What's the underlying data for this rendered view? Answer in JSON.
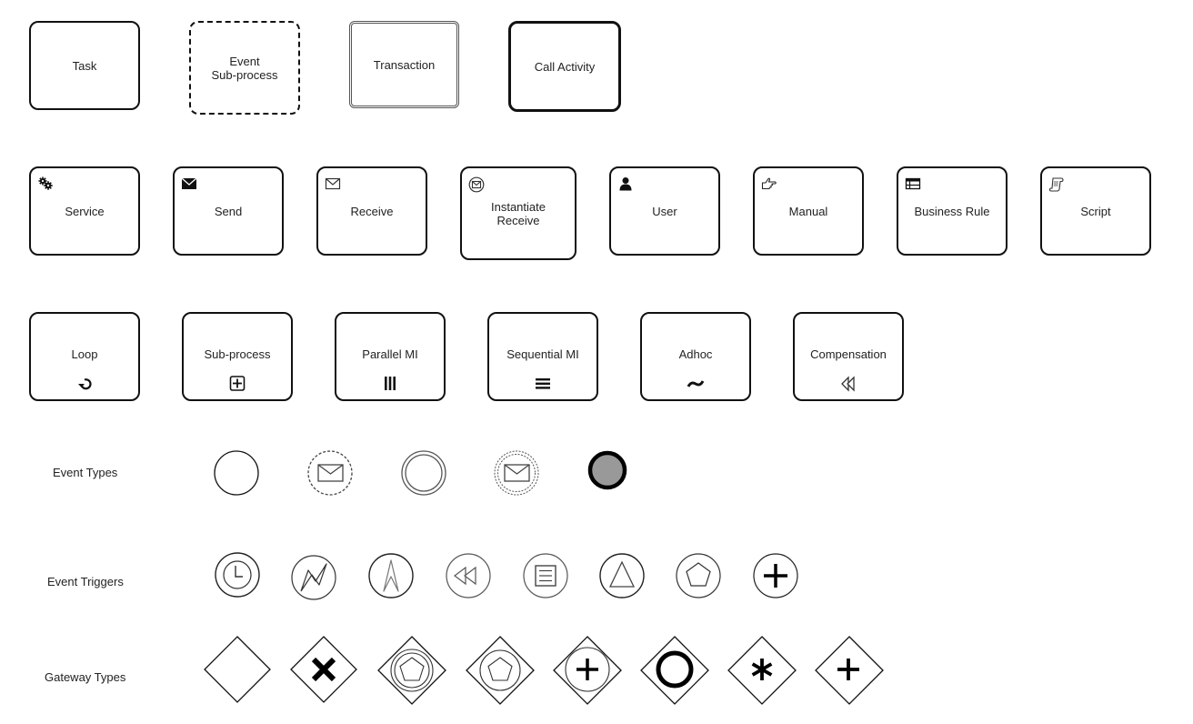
{
  "activities": [
    {
      "label": "Task",
      "style": "normal"
    },
    {
      "label": "Event\nSub-process",
      "style": "dashed"
    },
    {
      "label": "Transaction",
      "style": "double"
    },
    {
      "label": "Call Activity",
      "style": "thick"
    }
  ],
  "task_types": [
    {
      "label": "Service",
      "icon": "gears-icon"
    },
    {
      "label": "Send",
      "icon": "filled-envelope-icon"
    },
    {
      "label": "Receive",
      "icon": "envelope-icon"
    },
    {
      "label": "Instantiate\nReceive",
      "icon": "circled-envelope-icon"
    },
    {
      "label": "User",
      "icon": "user-icon"
    },
    {
      "label": "Manual",
      "icon": "hand-icon"
    },
    {
      "label": "Business Rule",
      "icon": "table-icon"
    },
    {
      "label": "Script",
      "icon": "scroll-icon"
    }
  ],
  "markers": [
    {
      "label": "Loop",
      "icon": "loop-icon"
    },
    {
      "label": "Sub-process",
      "icon": "plus-box-icon"
    },
    {
      "label": "Parallel MI",
      "icon": "parallel-bars-icon"
    },
    {
      "label": "Sequential MI",
      "icon": "sequential-bars-icon"
    },
    {
      "label": "Adhoc",
      "icon": "tilde-icon"
    },
    {
      "label": "Compensation",
      "icon": "rewind-icon"
    }
  ],
  "event_types": {
    "label": "Event Types",
    "items": [
      "start-event",
      "non-interrupting-message-event",
      "intermediate-event",
      "non-interrupting-intermediate-message-event",
      "end-event"
    ]
  },
  "event_triggers": {
    "label": "Event Triggers",
    "items": [
      "timer-icon",
      "error-icon",
      "escalation-icon",
      "compensation-icon",
      "conditional-icon",
      "signal-icon",
      "multiple-icon",
      "parallel-multiple-icon"
    ]
  },
  "gateway_types": {
    "label": "Gateway Types",
    "items": [
      "gateway",
      "exclusive-gateway",
      "event-based-gateway",
      "exclusive-event-based-gateway",
      "parallel-event-based-gateway",
      "inclusive-gateway",
      "complex-gateway",
      "parallel-gateway"
    ]
  },
  "colors": {
    "stroke": "#111111",
    "end_fill": "#999999",
    "light_stroke": "#555555"
  }
}
